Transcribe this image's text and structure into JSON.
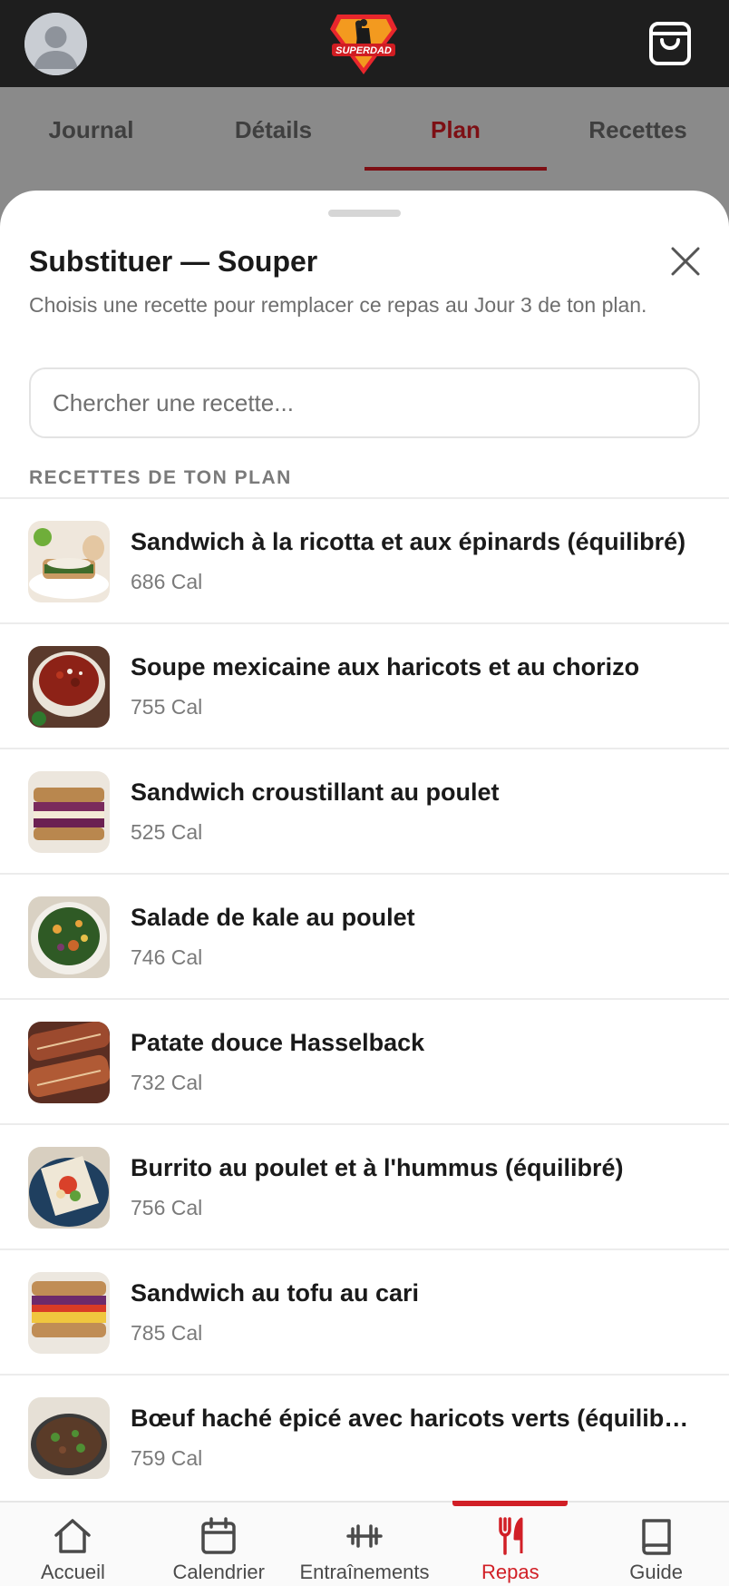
{
  "header": {
    "avatar_icon": "user-avatar-icon",
    "logo_text": "SUPERDAD",
    "cart_icon": "shopping-bag-icon"
  },
  "tabs": [
    {
      "label": "Journal",
      "active": false
    },
    {
      "label": "Détails",
      "active": false
    },
    {
      "label": "Plan",
      "active": true
    },
    {
      "label": "Recettes",
      "active": false
    }
  ],
  "sheet": {
    "title": "Substituer — Souper",
    "subtitle": "Choisis une recette pour remplacer ce repas au Jour 3 de ton plan.",
    "close_icon": "close-icon",
    "search_placeholder": "Chercher une recette...",
    "section_label": "RECETTES DE TON PLAN",
    "recipes": [
      {
        "name": "Sandwich à la ricotta et aux épinards (équilibré)",
        "calories": "686 Cal"
      },
      {
        "name": "Soupe mexicaine aux haricots et au chorizo",
        "calories": "755 Cal"
      },
      {
        "name": "Sandwich croustillant au poulet",
        "calories": "525 Cal"
      },
      {
        "name": "Salade de kale au poulet",
        "calories": "746 Cal"
      },
      {
        "name": "Patate douce Hasselback",
        "calories": "732 Cal"
      },
      {
        "name": "Burrito au poulet et à l'hummus (équilibré)",
        "calories": "756 Cal"
      },
      {
        "name": "Sandwich au tofu au cari",
        "calories": "785 Cal"
      },
      {
        "name": "Bœuf haché épicé avec haricots verts (équilibré)",
        "calories": "759 Cal"
      }
    ]
  },
  "bottom_nav": [
    {
      "label": "Accueil",
      "icon": "home-icon",
      "active": false
    },
    {
      "label": "Calendrier",
      "icon": "calendar-icon",
      "active": false
    },
    {
      "label": "Entraînements",
      "icon": "dumbbell-icon",
      "active": false
    },
    {
      "label": "Repas",
      "icon": "fork-knife-icon",
      "active": true
    },
    {
      "label": "Guide",
      "icon": "book-icon",
      "active": false
    }
  ],
  "colors": {
    "accent": "#d11f26",
    "tab_active": "#7d0f14",
    "topbar": "#1e1e1e"
  }
}
